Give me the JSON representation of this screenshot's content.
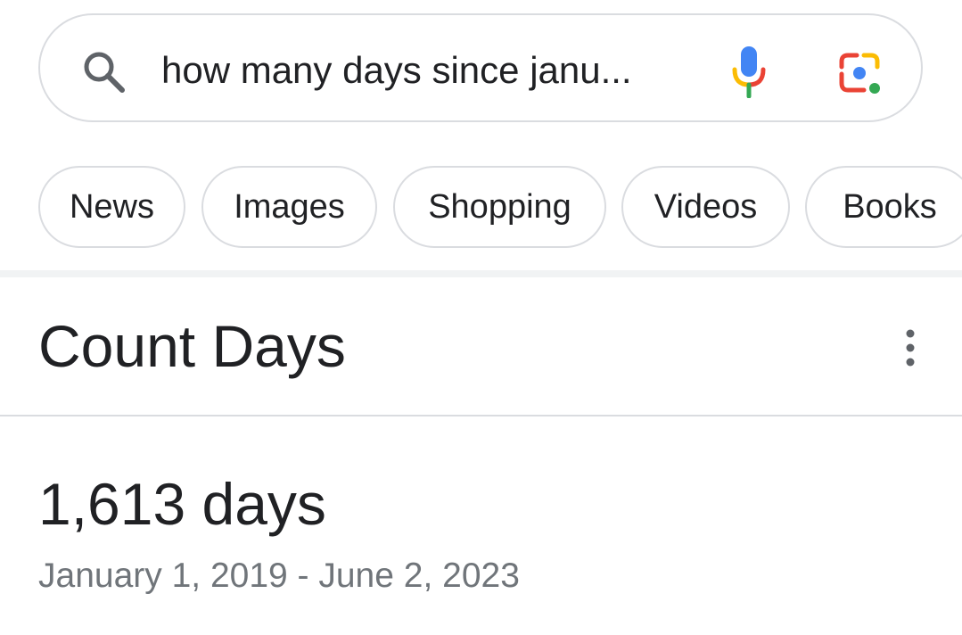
{
  "search": {
    "query": "how many days since janu...",
    "icons": {
      "search": "search-icon",
      "voice": "microphone-icon",
      "lens": "google-lens-icon"
    }
  },
  "filters": [
    {
      "label": "News"
    },
    {
      "label": "Images"
    },
    {
      "label": "Shopping"
    },
    {
      "label": "Videos"
    },
    {
      "label": "Books"
    }
  ],
  "card": {
    "title": "Count Days",
    "menu_icon": "more-vertical-icon",
    "result": {
      "value": "1,613 days",
      "range": "January 1, 2019 - June 2, 2023"
    }
  },
  "colors": {
    "blue": "#4285F4",
    "red": "#EA4335",
    "yellow": "#FBBC04",
    "green": "#34A853",
    "text_primary": "#202124",
    "text_secondary": "#70757a",
    "border": "#dadce0"
  }
}
